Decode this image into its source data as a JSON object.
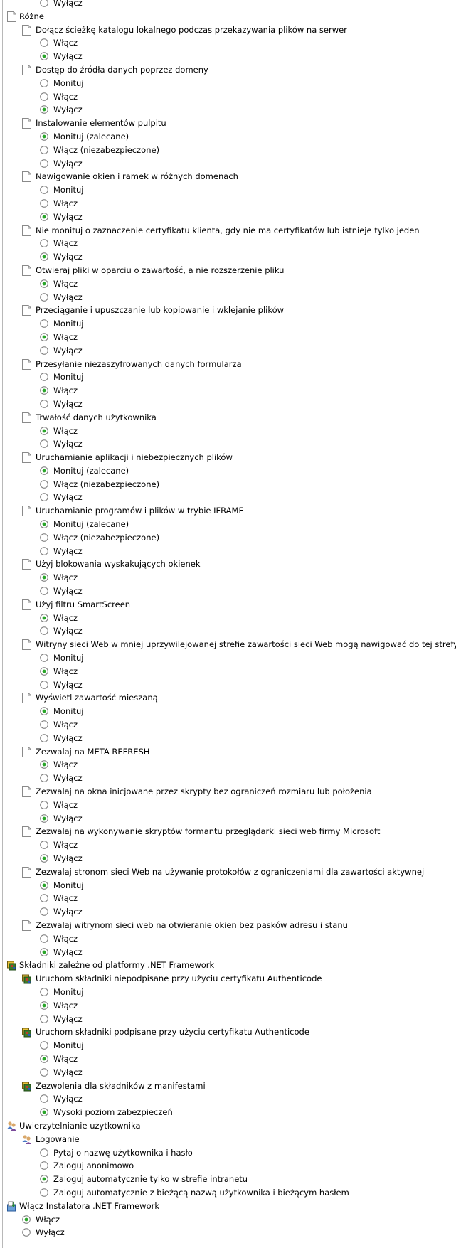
{
  "tree": [
    {
      "type": "radio",
      "level": 3,
      "label": "Wyłącz",
      "checked": false,
      "partial": true
    },
    {
      "type": "category",
      "level": 1,
      "icon": "document-icon",
      "label": "Różne"
    },
    {
      "type": "policy",
      "level": 2,
      "icon": "document-icon",
      "label": "Dołącz ścieżkę katalogu lokalnego podczas przekazywania plików na serwer"
    },
    {
      "type": "radio",
      "level": 3,
      "label": "Włącz",
      "checked": false
    },
    {
      "type": "radio",
      "level": 3,
      "label": "Wyłącz",
      "checked": true
    },
    {
      "type": "policy",
      "level": 2,
      "icon": "document-icon",
      "label": "Dostęp do źródła danych poprzez domeny"
    },
    {
      "type": "radio",
      "level": 3,
      "label": "Monituj",
      "checked": false
    },
    {
      "type": "radio",
      "level": 3,
      "label": "Włącz",
      "checked": false
    },
    {
      "type": "radio",
      "level": 3,
      "label": "Wyłącz",
      "checked": true
    },
    {
      "type": "policy",
      "level": 2,
      "icon": "document-icon",
      "label": "Instalowanie elementów pulpitu"
    },
    {
      "type": "radio",
      "level": 3,
      "label": "Monituj (zalecane)",
      "checked": true
    },
    {
      "type": "radio",
      "level": 3,
      "label": "Włącz (niezabezpieczone)",
      "checked": false
    },
    {
      "type": "radio",
      "level": 3,
      "label": "Wyłącz",
      "checked": false
    },
    {
      "type": "policy",
      "level": 2,
      "icon": "document-icon",
      "label": "Nawigowanie okien i ramek w różnych domenach"
    },
    {
      "type": "radio",
      "level": 3,
      "label": "Monituj",
      "checked": false
    },
    {
      "type": "radio",
      "level": 3,
      "label": "Włącz",
      "checked": false
    },
    {
      "type": "radio",
      "level": 3,
      "label": "Wyłącz",
      "checked": true
    },
    {
      "type": "policy",
      "level": 2,
      "icon": "document-icon",
      "label": "Nie monituj o zaznaczenie certyfikatu klienta, gdy nie ma certyfikatów lub istnieje tylko jeden"
    },
    {
      "type": "radio",
      "level": 3,
      "label": "Włącz",
      "checked": false
    },
    {
      "type": "radio",
      "level": 3,
      "label": "Wyłącz",
      "checked": true
    },
    {
      "type": "policy",
      "level": 2,
      "icon": "document-icon",
      "label": "Otwieraj pliki w oparciu o zawartość, a nie rozszerzenie pliku"
    },
    {
      "type": "radio",
      "level": 3,
      "label": "Włącz",
      "checked": true
    },
    {
      "type": "radio",
      "level": 3,
      "label": "Wyłącz",
      "checked": false
    },
    {
      "type": "policy",
      "level": 2,
      "icon": "document-icon",
      "label": "Przeciąganie i upuszczanie lub kopiowanie i wklejanie plików"
    },
    {
      "type": "radio",
      "level": 3,
      "label": "Monituj",
      "checked": false
    },
    {
      "type": "radio",
      "level": 3,
      "label": "Włącz",
      "checked": true
    },
    {
      "type": "radio",
      "level": 3,
      "label": "Wyłącz",
      "checked": false
    },
    {
      "type": "policy",
      "level": 2,
      "icon": "document-icon",
      "label": "Przesyłanie niezaszyfrowanych danych formularza"
    },
    {
      "type": "radio",
      "level": 3,
      "label": "Monituj",
      "checked": false
    },
    {
      "type": "radio",
      "level": 3,
      "label": "Włącz",
      "checked": true
    },
    {
      "type": "radio",
      "level": 3,
      "label": "Wyłącz",
      "checked": false
    },
    {
      "type": "policy",
      "level": 2,
      "icon": "document-icon",
      "label": "Trwałość danych użytkownika"
    },
    {
      "type": "radio",
      "level": 3,
      "label": "Włącz",
      "checked": true
    },
    {
      "type": "radio",
      "level": 3,
      "label": "Wyłącz",
      "checked": false
    },
    {
      "type": "policy",
      "level": 2,
      "icon": "document-icon",
      "label": "Uruchamianie aplikacji i niebezpiecznych plików"
    },
    {
      "type": "radio",
      "level": 3,
      "label": "Monituj (zalecane)",
      "checked": true
    },
    {
      "type": "radio",
      "level": 3,
      "label": "Włącz (niezabezpieczone)",
      "checked": false
    },
    {
      "type": "radio",
      "level": 3,
      "label": "Wyłącz",
      "checked": false
    },
    {
      "type": "policy",
      "level": 2,
      "icon": "document-icon",
      "label": "Uruchamianie programów i plików w trybie IFRAME"
    },
    {
      "type": "radio",
      "level": 3,
      "label": "Monituj (zalecane)",
      "checked": true
    },
    {
      "type": "radio",
      "level": 3,
      "label": "Włącz (niezabezpieczone)",
      "checked": false
    },
    {
      "type": "radio",
      "level": 3,
      "label": "Wyłącz",
      "checked": false
    },
    {
      "type": "policy",
      "level": 2,
      "icon": "document-icon",
      "label": "Użyj blokowania wyskakujących okienek"
    },
    {
      "type": "radio",
      "level": 3,
      "label": "Włącz",
      "checked": true
    },
    {
      "type": "radio",
      "level": 3,
      "label": "Wyłącz",
      "checked": false
    },
    {
      "type": "policy",
      "level": 2,
      "icon": "document-icon",
      "label": "Użyj filtru SmartScreen"
    },
    {
      "type": "radio",
      "level": 3,
      "label": "Włącz",
      "checked": true
    },
    {
      "type": "radio",
      "level": 3,
      "label": "Wyłącz",
      "checked": false
    },
    {
      "type": "policy",
      "level": 2,
      "icon": "document-icon",
      "label": "Witryny sieci Web w mniej uprzywilejowanej strefie zawartości sieci Web mogą nawigować do tej strefy"
    },
    {
      "type": "radio",
      "level": 3,
      "label": "Monituj",
      "checked": false
    },
    {
      "type": "radio",
      "level": 3,
      "label": "Włącz",
      "checked": true
    },
    {
      "type": "radio",
      "level": 3,
      "label": "Wyłącz",
      "checked": false
    },
    {
      "type": "policy",
      "level": 2,
      "icon": "document-icon",
      "label": "Wyświetl zawartość mieszaną"
    },
    {
      "type": "radio",
      "level": 3,
      "label": "Monituj",
      "checked": true
    },
    {
      "type": "radio",
      "level": 3,
      "label": "Włącz",
      "checked": false
    },
    {
      "type": "radio",
      "level": 3,
      "label": "Wyłącz",
      "checked": false
    },
    {
      "type": "policy",
      "level": 2,
      "icon": "document-icon",
      "label": "Zezwalaj na META REFRESH"
    },
    {
      "type": "radio",
      "level": 3,
      "label": "Włącz",
      "checked": true
    },
    {
      "type": "radio",
      "level": 3,
      "label": "Wyłącz",
      "checked": false
    },
    {
      "type": "policy",
      "level": 2,
      "icon": "document-icon",
      "label": "Zezwalaj na okna inicjowane przez skrypty bez ograniczeń rozmiaru lub położenia"
    },
    {
      "type": "radio",
      "level": 3,
      "label": "Włącz",
      "checked": false
    },
    {
      "type": "radio",
      "level": 3,
      "label": "Wyłącz",
      "checked": true
    },
    {
      "type": "policy",
      "level": 2,
      "icon": "document-icon",
      "label": "Zezwalaj na wykonywanie skryptów formantu przeglądarki sieci web firmy Microsoft"
    },
    {
      "type": "radio",
      "level": 3,
      "label": "Włącz",
      "checked": false
    },
    {
      "type": "radio",
      "level": 3,
      "label": "Wyłącz",
      "checked": true
    },
    {
      "type": "policy",
      "level": 2,
      "icon": "document-icon",
      "label": "Zezwalaj stronom sieci Web na używanie protokołów z ograniczeniami dla zawartości aktywnej"
    },
    {
      "type": "radio",
      "level": 3,
      "label": "Monituj",
      "checked": true
    },
    {
      "type": "radio",
      "level": 3,
      "label": "Włącz",
      "checked": false
    },
    {
      "type": "radio",
      "level": 3,
      "label": "Wyłącz",
      "checked": false
    },
    {
      "type": "policy",
      "level": 2,
      "icon": "document-icon",
      "label": "Zezwalaj witrynom sieci web na otwieranie okien bez pasków adresu i stanu"
    },
    {
      "type": "radio",
      "level": 3,
      "label": "Włącz",
      "checked": false
    },
    {
      "type": "radio",
      "level": 3,
      "label": "Wyłącz",
      "checked": true
    },
    {
      "type": "category",
      "level": 1,
      "icon": "dotnet-component-icon",
      "label": "Składniki zależne od platformy .NET Framework"
    },
    {
      "type": "policy",
      "level": 2,
      "icon": "dotnet-component-icon",
      "label": "Uruchom składniki niepodpisane przy użyciu certyfikatu Authenticode"
    },
    {
      "type": "radio",
      "level": 3,
      "label": "Monituj",
      "checked": false
    },
    {
      "type": "radio",
      "level": 3,
      "label": "Włącz",
      "checked": true
    },
    {
      "type": "radio",
      "level": 3,
      "label": "Wyłącz",
      "checked": false
    },
    {
      "type": "policy",
      "level": 2,
      "icon": "dotnet-component-icon",
      "label": "Uruchom składniki podpisane przy użyciu certyfikatu Authenticode"
    },
    {
      "type": "radio",
      "level": 3,
      "label": "Monituj",
      "checked": false
    },
    {
      "type": "radio",
      "level": 3,
      "label": "Włącz",
      "checked": true
    },
    {
      "type": "radio",
      "level": 3,
      "label": "Wyłącz",
      "checked": false
    },
    {
      "type": "policy",
      "level": 2,
      "icon": "dotnet-component-icon",
      "label": "Zezwolenia dla składników z manifestami"
    },
    {
      "type": "radio",
      "level": 3,
      "label": "Wyłącz",
      "checked": false
    },
    {
      "type": "radio",
      "level": 3,
      "label": "Wysoki poziom zabezpieczeń",
      "checked": true
    },
    {
      "type": "category",
      "level": 1,
      "icon": "users-icon",
      "label": "Uwierzytelnianie użytkownika"
    },
    {
      "type": "policy",
      "level": 2,
      "icon": "users-icon",
      "label": "Logowanie"
    },
    {
      "type": "radio",
      "level": 3,
      "label": "Pytaj o nazwę użytkownika i hasło",
      "checked": false
    },
    {
      "type": "radio",
      "level": 3,
      "label": "Zaloguj anonimowo",
      "checked": false
    },
    {
      "type": "radio",
      "level": 3,
      "label": "Zaloguj automatycznie tylko w strefie intranetu",
      "checked": true
    },
    {
      "type": "radio",
      "level": 3,
      "label": "Zaloguj automatycznie z bieżącą nazwą użytkownika i bieżącym hasłem",
      "checked": false
    },
    {
      "type": "category",
      "level": 1,
      "icon": "installer-icon",
      "label": "Włącz Instalatora .NET Framework"
    },
    {
      "type": "radio",
      "level": 2,
      "label": "Włącz",
      "checked": true
    },
    {
      "type": "radio",
      "level": 2,
      "label": "Wyłącz",
      "checked": false
    }
  ],
  "colors": {
    "radio_dot": "#2aa52a",
    "radio_border": "#7a7a7a",
    "line": "#b8b8b8",
    "doc_border": "#8a8a8a"
  }
}
